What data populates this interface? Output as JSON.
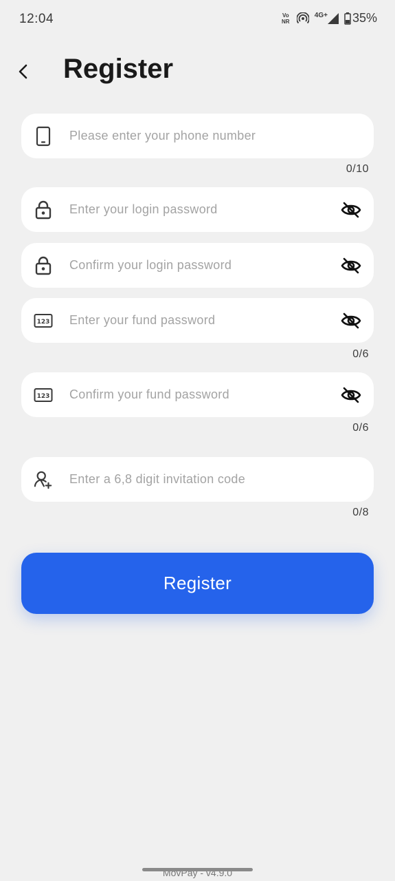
{
  "status_bar": {
    "time": "12:04",
    "volte_top": "Vo",
    "volte_bottom": "NR",
    "network": "4G+",
    "battery": "35%"
  },
  "header": {
    "title": "Register"
  },
  "fields": [
    {
      "icon": "phone-icon",
      "placeholder": "Please enter your phone number",
      "counter": "0/10"
    },
    {
      "icon": "lock-icon",
      "placeholder": "Enter your login password"
    },
    {
      "icon": "lock-icon",
      "placeholder": "Confirm your login password"
    },
    {
      "icon": "numeric-123-icon",
      "placeholder": "Enter your fund password",
      "counter": "0/6"
    },
    {
      "icon": "numeric-123-icon",
      "placeholder": "Confirm your fund password",
      "counter": "0/6"
    },
    {
      "icon": "add-user-icon",
      "placeholder": "Enter a 6,8 digit invitation code",
      "counter": "0/8"
    }
  ],
  "register_button": {
    "label": "Register",
    "color": "#2563eb"
  },
  "footer": {
    "version": "MovPay - v4.9.0"
  }
}
